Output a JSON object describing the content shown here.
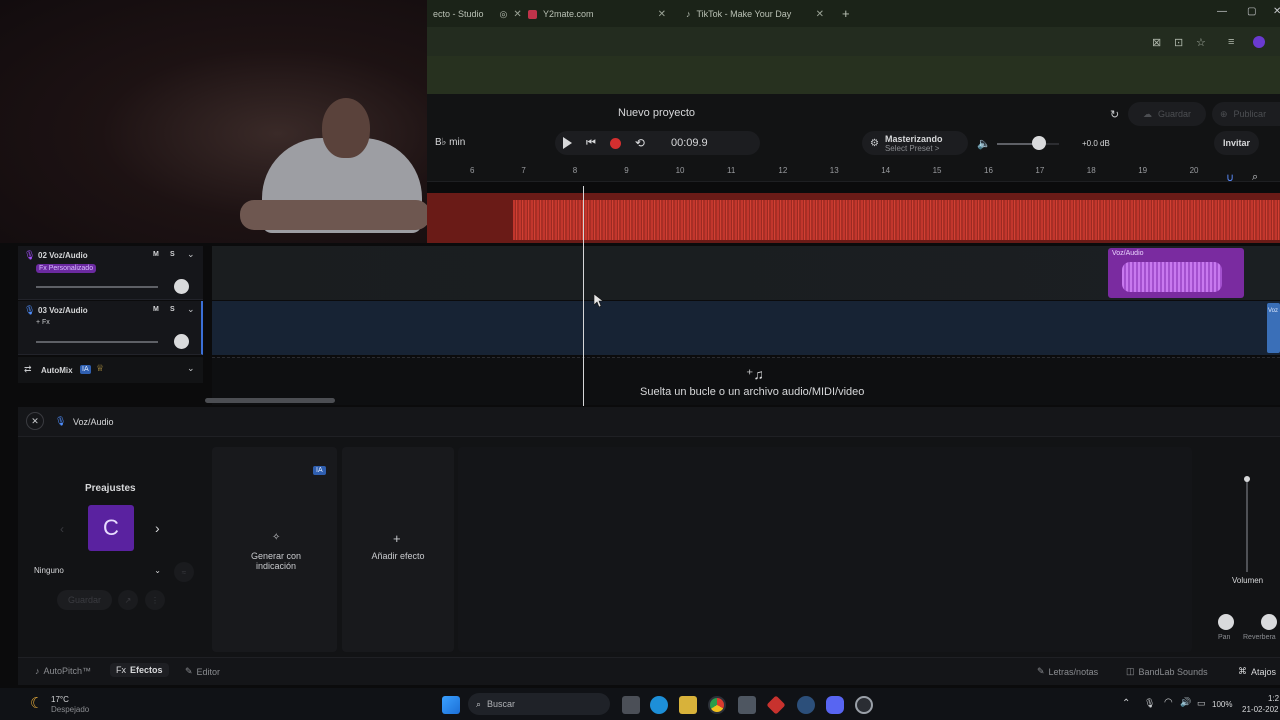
{
  "browser": {
    "tabs": [
      {
        "label": "ecto - Studio"
      },
      {
        "label": "Y2mate.com"
      },
      {
        "label": "TikTok - Make Your Day"
      }
    ],
    "new_tab": "+"
  },
  "header": {
    "project_title": "Nuevo proyecto",
    "save_label": "Guardar",
    "publish_label": "Publicar",
    "invite_label": "Invitar",
    "metronome_label": "B♭ min",
    "time": "00:09.9",
    "mastering_title": "Masterizando",
    "mastering_sub": "Select Preset >",
    "gain": "+0.0 dB",
    "volume_level": 0.65
  },
  "ruler": [
    "6",
    "7",
    "8",
    "9",
    "10",
    "11",
    "12",
    "13",
    "14",
    "15",
    "16",
    "17",
    "18",
    "19",
    "20"
  ],
  "tracks": [
    {
      "number": "02",
      "name": "Voz/Audio",
      "badge": "Fx Personalizado",
      "m": "M",
      "s": "S"
    },
    {
      "number": "03",
      "name": "Voz/Audio",
      "badge": "+ Fx",
      "m": "M",
      "s": "S"
    }
  ],
  "clip_label": "Voz/Audio",
  "clip_label_2": "Voz",
  "automix": {
    "label": "AutoMix",
    "ia": "IA"
  },
  "drop_text": "Suelta un bucle o un archivo audio/MIDI/video",
  "fx_panel": {
    "title": "Voz/Audio",
    "presets_title": "Preajustes",
    "preset_letter": "C",
    "preset_select": "Ninguno",
    "save_label": "Guardar",
    "ia_badge": "IA",
    "generate_label": "Generar con indicación",
    "add_effect_label": "Añadir efecto",
    "volume_label": "Volumen",
    "pan_label": "Pan",
    "reverb_label": "Reverbera"
  },
  "bottom": {
    "autopitch": "AutoPitch™",
    "fx_prefix": "Fx",
    "effects": "Efectos",
    "editor": "Editor",
    "lyrics": "Letras/notas",
    "sounds": "BandLab Sounds",
    "shortcuts": "Atajos"
  },
  "taskbar": {
    "temp": "17°C",
    "weather": "Despejado",
    "search": "Buscar",
    "battery": "100%",
    "time": "1:2",
    "date": "21-02-202"
  }
}
